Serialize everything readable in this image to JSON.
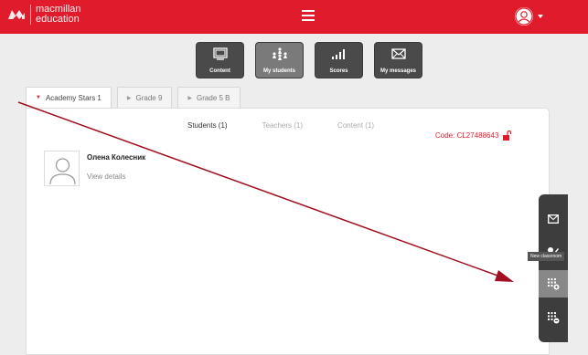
{
  "header": {
    "logo_line1": "macmillan",
    "logo_line2": "education"
  },
  "toolbar": {
    "buttons": [
      {
        "label": "Content",
        "icon": "content-icon"
      },
      {
        "label": "My students",
        "icon": "students-icon"
      },
      {
        "label": "Scores",
        "icon": "scores-icon"
      },
      {
        "label": "My messages",
        "icon": "messages-icon"
      }
    ],
    "active": "My students"
  },
  "class_tabs": [
    {
      "label": "Academy Stars 1",
      "active": true
    },
    {
      "label": "Grade 9",
      "active": false
    },
    {
      "label": "Grade 5 B",
      "active": false
    }
  ],
  "subtabs": [
    {
      "label": "Students (1)",
      "active": true
    },
    {
      "label": "Teachers (1)",
      "active": false
    },
    {
      "label": "Content (1)",
      "active": false
    }
  ],
  "class_code": "Code: CL27488643",
  "students": [
    {
      "name": "Олена Колесник",
      "link": "View details"
    }
  ],
  "side_panel": {
    "tooltip": "New classroom",
    "items": [
      "message-icon",
      "edit-icon",
      "new-classroom-icon",
      "remove-classroom-icon"
    ]
  },
  "colors": {
    "brand_red": "#e01b2b",
    "toolbar_dark": "#4a4a4a",
    "arrow": "#a01020"
  }
}
